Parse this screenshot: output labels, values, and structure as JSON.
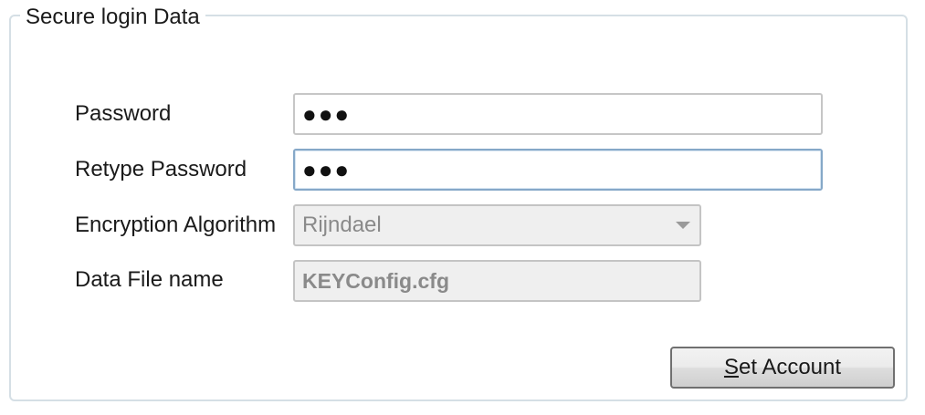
{
  "group": {
    "title": "Secure login Data"
  },
  "fields": {
    "password": {
      "label": "Password",
      "value": "●●●"
    },
    "retype_password": {
      "label": "Retype Password",
      "value": "●●●"
    },
    "encryption_algorithm": {
      "label": "Encryption Algorithm",
      "selected": "Rijndael"
    },
    "data_file_name": {
      "label": "Data File name",
      "value": "KEYConfig.cfg"
    }
  },
  "actions": {
    "set_account": {
      "mnemonic": "S",
      "rest": "et Account"
    }
  }
}
